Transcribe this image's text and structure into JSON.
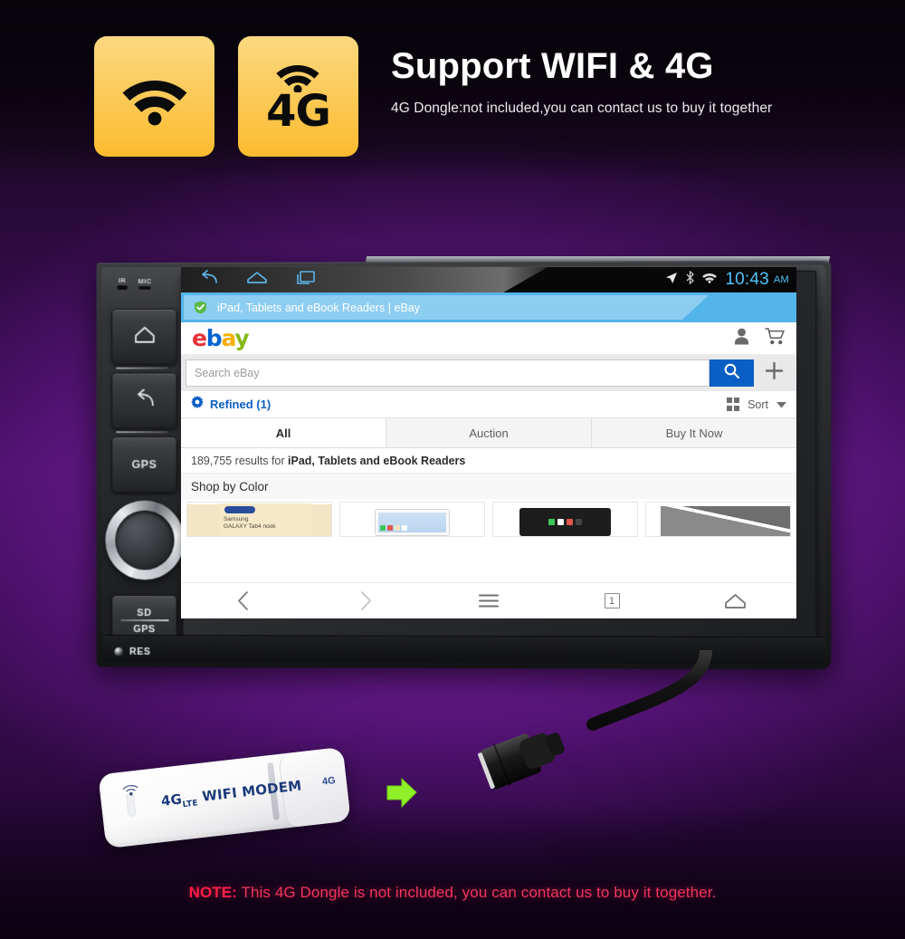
{
  "header": {
    "badges": [
      {
        "icon": "wifi-icon",
        "label": ""
      },
      {
        "icon": "4g-wifi-icon",
        "label": "4G"
      }
    ],
    "title": "Support WIFI & 4G",
    "subtitle": "4G Dongle:not included,you can contact us to buy it together"
  },
  "device": {
    "sensors": [
      {
        "name": "IR",
        "label": "IR"
      },
      {
        "name": "MIC",
        "label": "MIC"
      }
    ],
    "buttons": [
      {
        "name": "home",
        "icon": "home-icon",
        "label": ""
      },
      {
        "name": "back",
        "icon": "back-arrow-icon",
        "label": ""
      },
      {
        "name": "gps",
        "icon": "",
        "label": "GPS"
      }
    ],
    "knob": {
      "name": "volume-knob"
    },
    "card_slot": {
      "line1": "SD",
      "line2": "GPS"
    },
    "reset": {
      "label": "RES"
    }
  },
  "android": {
    "nav": [
      {
        "name": "back",
        "icon": "back-arrow-icon"
      },
      {
        "name": "home",
        "icon": "home-icon"
      },
      {
        "name": "recents",
        "icon": "recent-apps-icon"
      }
    ],
    "status_icons": [
      "location-arrow-icon",
      "bluetooth-icon",
      "wifi-icon"
    ],
    "time": "10:43",
    "ampm": "AM"
  },
  "browser": {
    "tab_title": "iPad, Tablets and eBook Readers | eBay",
    "tab_secure_icon": "shield-check-icon",
    "nav": [
      {
        "name": "back",
        "icon": "chevron-left-icon",
        "label": ""
      },
      {
        "name": "forward",
        "icon": "chevron-right-icon",
        "label": ""
      },
      {
        "name": "menu",
        "icon": "hamburger-icon",
        "label": ""
      },
      {
        "name": "tabs",
        "icon": "tab-count-icon",
        "label": "1"
      },
      {
        "name": "home",
        "icon": "home-icon",
        "label": ""
      }
    ]
  },
  "ebay": {
    "logo": {
      "e": "e",
      "b": "b",
      "a": "a",
      "y": "y"
    },
    "header_icons": [
      "user-icon",
      "cart-icon"
    ],
    "search": {
      "placeholder": "Search eBay",
      "value": "",
      "button_icon": "search-icon",
      "add_icon": "plus-icon"
    },
    "refined": {
      "label": "Refined (1)",
      "icon": "gear-icon"
    },
    "sort": {
      "label": "Sort",
      "grid_icon": "grid-view-icon",
      "caret_icon": "chevron-down-icon"
    },
    "tabs": [
      {
        "label": "All",
        "active": true
      },
      {
        "label": "Auction",
        "active": false
      },
      {
        "label": "Buy It Now",
        "active": false
      }
    ],
    "results_count": "189,755",
    "results_prefix": "189,755 results for ",
    "results_query": "iPad, Tablets and eBook Readers",
    "shop_by": "Shop by Color",
    "thumbnails": [
      {
        "name": "samsung-galaxy-tab4-nook",
        "brand": "Samsung",
        "line1": "Samsung",
        "line2": "GALAXY Tab4 nook"
      },
      {
        "name": "white-tablet",
        "brand": "",
        "line1": "",
        "line2": ""
      },
      {
        "name": "black-tablet",
        "brand": "",
        "line1": "",
        "line2": ""
      },
      {
        "name": "grey-tablet",
        "brand": "",
        "line1": "",
        "line2": ""
      }
    ]
  },
  "dongle": {
    "brand": "4G",
    "brand_sub": "LTE",
    "model": "WIFI MODEM",
    "cap_text": "4G",
    "full_label": "4G LTE WIFI MODEM"
  },
  "note": {
    "prefix": "NOTE:",
    "text": " This 4G Dongle is not included, you can contact us to buy it together."
  },
  "colors": {
    "badge": "#fcbb2e",
    "accent_blue": "#0b5ec4",
    "tab_blue": "#53b4ea",
    "note_red": "#ff1f49",
    "clock_blue": "#4fc3f7"
  }
}
